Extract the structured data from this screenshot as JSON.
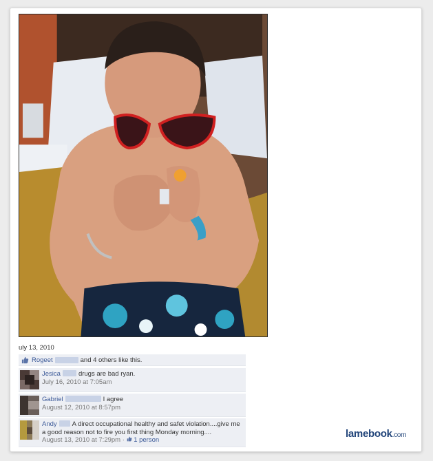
{
  "post": {
    "date": "uly 13, 2010"
  },
  "likes": {
    "name": "Rogeet",
    "suffix": "and 4 others like this."
  },
  "comments": [
    {
      "author": "Jesica",
      "text": "drugs are bad ryan.",
      "time": "July 16, 2010 at 7:05am"
    },
    {
      "author": "Gabriel",
      "text": "I agree",
      "time": "August 12, 2010 at 8:57pm"
    },
    {
      "author": "Andy",
      "text": "A direct occupational healthy and safet violation....give me a good reason not to fire you first thing Monday morning....",
      "time": "August 13, 2010 at 7:29pm",
      "like_count": "1 person"
    }
  ],
  "watermark": {
    "brand": "lamebook",
    "domain": ".com"
  },
  "colors": {
    "link": "#3b5998",
    "comment_bg": "#edeff4",
    "watermark": "#22457a"
  }
}
